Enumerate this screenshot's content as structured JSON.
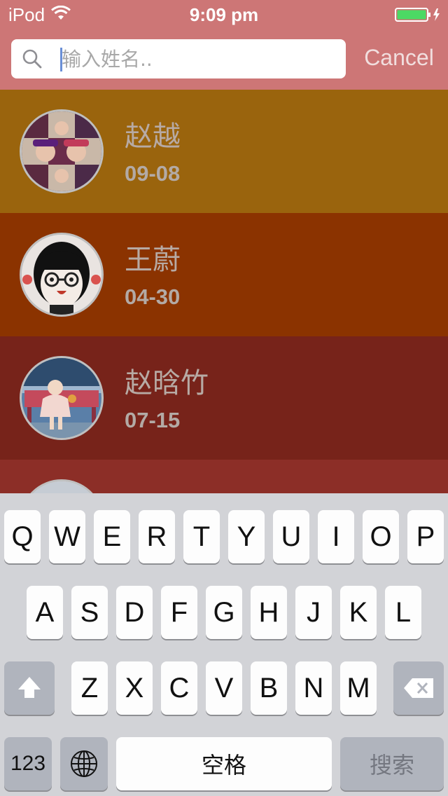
{
  "status_bar": {
    "carrier": "iPod",
    "time": "9:09 pm"
  },
  "search": {
    "placeholder": "输入姓名..",
    "value": "",
    "cancel_label": "Cancel"
  },
  "contacts": [
    {
      "name": "赵越",
      "date": "09-08"
    },
    {
      "name": "王蔚",
      "date": "04-30"
    },
    {
      "name": "赵晗竹",
      "date": "07-15"
    },
    {
      "name": "",
      "date": ""
    }
  ],
  "keyboard": {
    "row1": [
      "Q",
      "W",
      "E",
      "R",
      "T",
      "Y",
      "U",
      "I",
      "O",
      "P"
    ],
    "row2": [
      "A",
      "S",
      "D",
      "F",
      "G",
      "H",
      "J",
      "K",
      "L"
    ],
    "row3": [
      "Z",
      "X",
      "C",
      "V",
      "B",
      "N",
      "M"
    ],
    "num_label": "123",
    "space_label": "空格",
    "search_label": "搜索",
    "icons": {
      "shift": "shift-icon",
      "delete": "delete-icon",
      "globe": "globe-icon"
    }
  },
  "colors": {
    "header": "#cd7676",
    "row_colors": [
      "#9a640d",
      "#8b3300",
      "#77231a",
      "#8c2e27"
    ],
    "battery": "#4cd964"
  }
}
